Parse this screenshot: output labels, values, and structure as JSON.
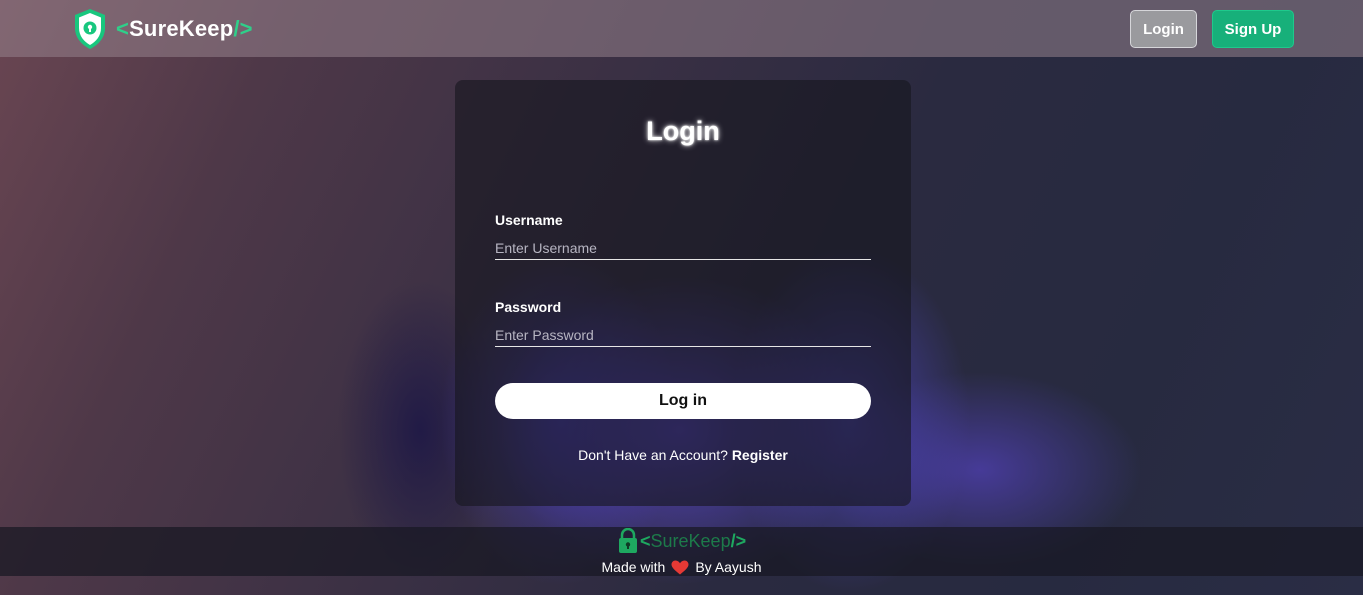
{
  "navbar": {
    "brand": {
      "open": "<",
      "name": "SureKeep",
      "close": "/>"
    },
    "login_label": "Login",
    "signup_label": "Sign Up"
  },
  "card": {
    "title": "Login",
    "username": {
      "label": "Username",
      "placeholder": "Enter Username",
      "value": ""
    },
    "password": {
      "label": "Password",
      "placeholder": "Enter Password",
      "value": ""
    },
    "submit_label": "Log in",
    "register_prompt": "Don't Have an Account?",
    "register_link": "Register"
  },
  "footer": {
    "brand": {
      "open": "<",
      "name": "SureKeep",
      "close": "/>"
    },
    "made_with": "Made with",
    "by": "By Aayush"
  },
  "colors": {
    "accent_green": "#17b07a",
    "heart_red": "#e53935"
  },
  "icons": [
    "shield-lock-icon",
    "padlock-icon",
    "heart-icon"
  ]
}
